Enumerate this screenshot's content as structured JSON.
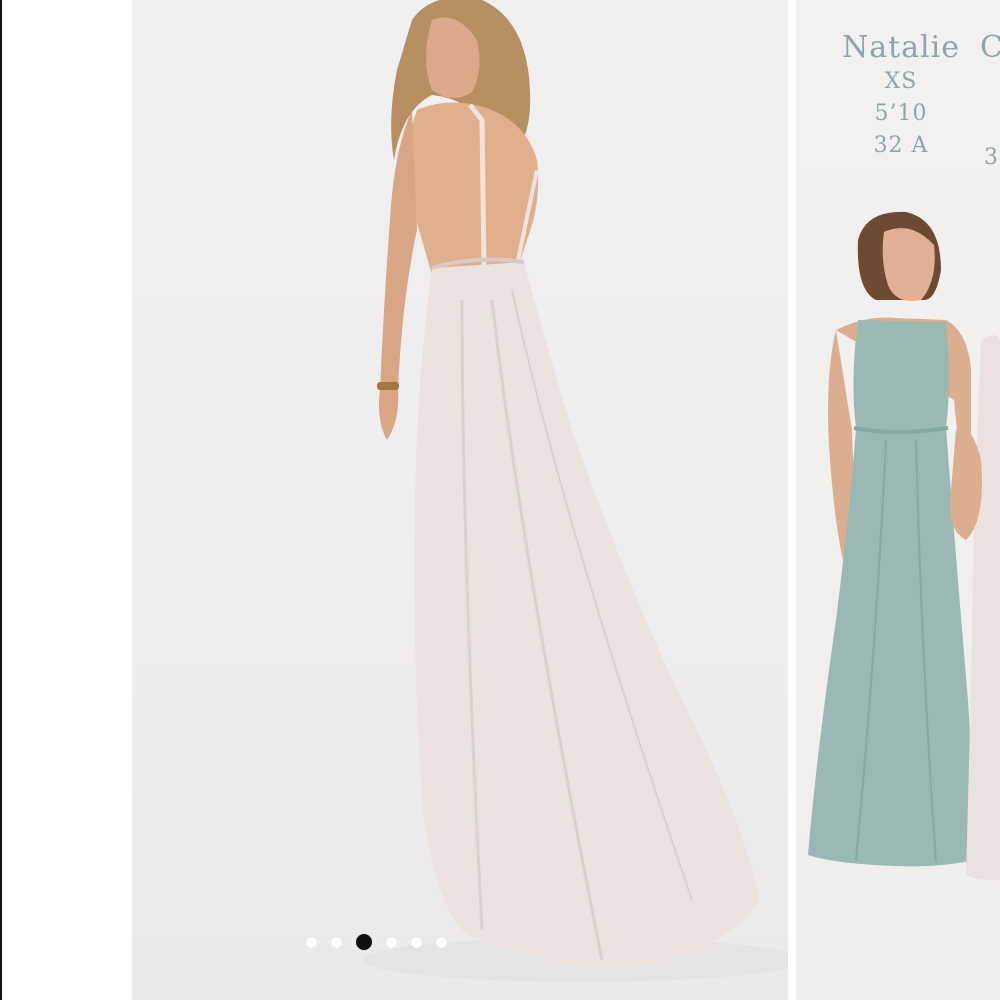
{
  "gallery": {
    "model_name": "Natalie",
    "model_size": "XS",
    "model_height": "5’10",
    "model_bust": "32 A",
    "next_model_initial": "C",
    "next_model_bust_fragment": "3",
    "active_slide": 3,
    "slide_count": 6,
    "colors": {
      "dress_main": "#ece2df",
      "dress_teal": "#9ab9b5",
      "label_text": "#8fa5aa",
      "dot_active": "#111111",
      "dot_inactive": "#ffffff"
    }
  }
}
